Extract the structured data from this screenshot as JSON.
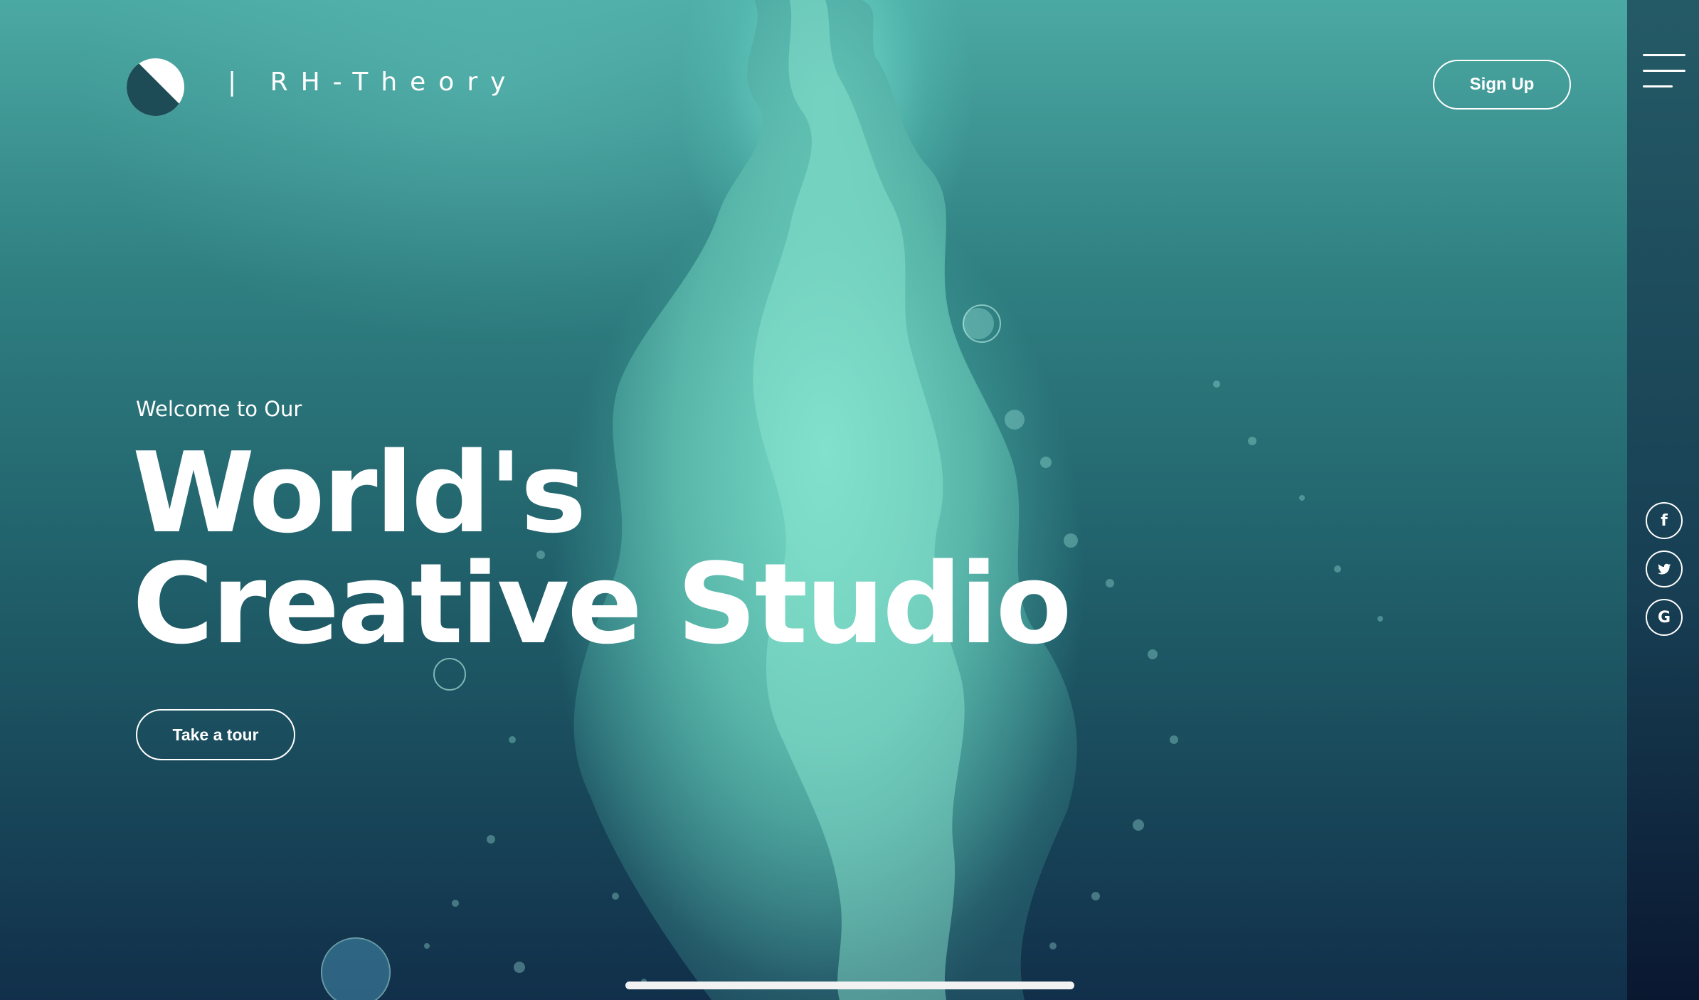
{
  "header": {
    "brand": "| RH-Theory",
    "signup_label": "Sign Up"
  },
  "hero": {
    "welcome": "Welcome to Our",
    "title_line1": "World's",
    "title_line2": "Creative Studio",
    "cta_label": "Take a tour"
  },
  "social": {
    "facebook_label": "f",
    "google_label": "G"
  },
  "icons": {
    "logo": "half-circle-logo",
    "menu": "hamburger-menu-icon",
    "facebook": "facebook-icon",
    "twitter": "twitter-icon",
    "google": "google-icon"
  },
  "colors": {
    "accent": "#58c8b8",
    "text": "#ffffff",
    "sidebar": "#173e53"
  }
}
